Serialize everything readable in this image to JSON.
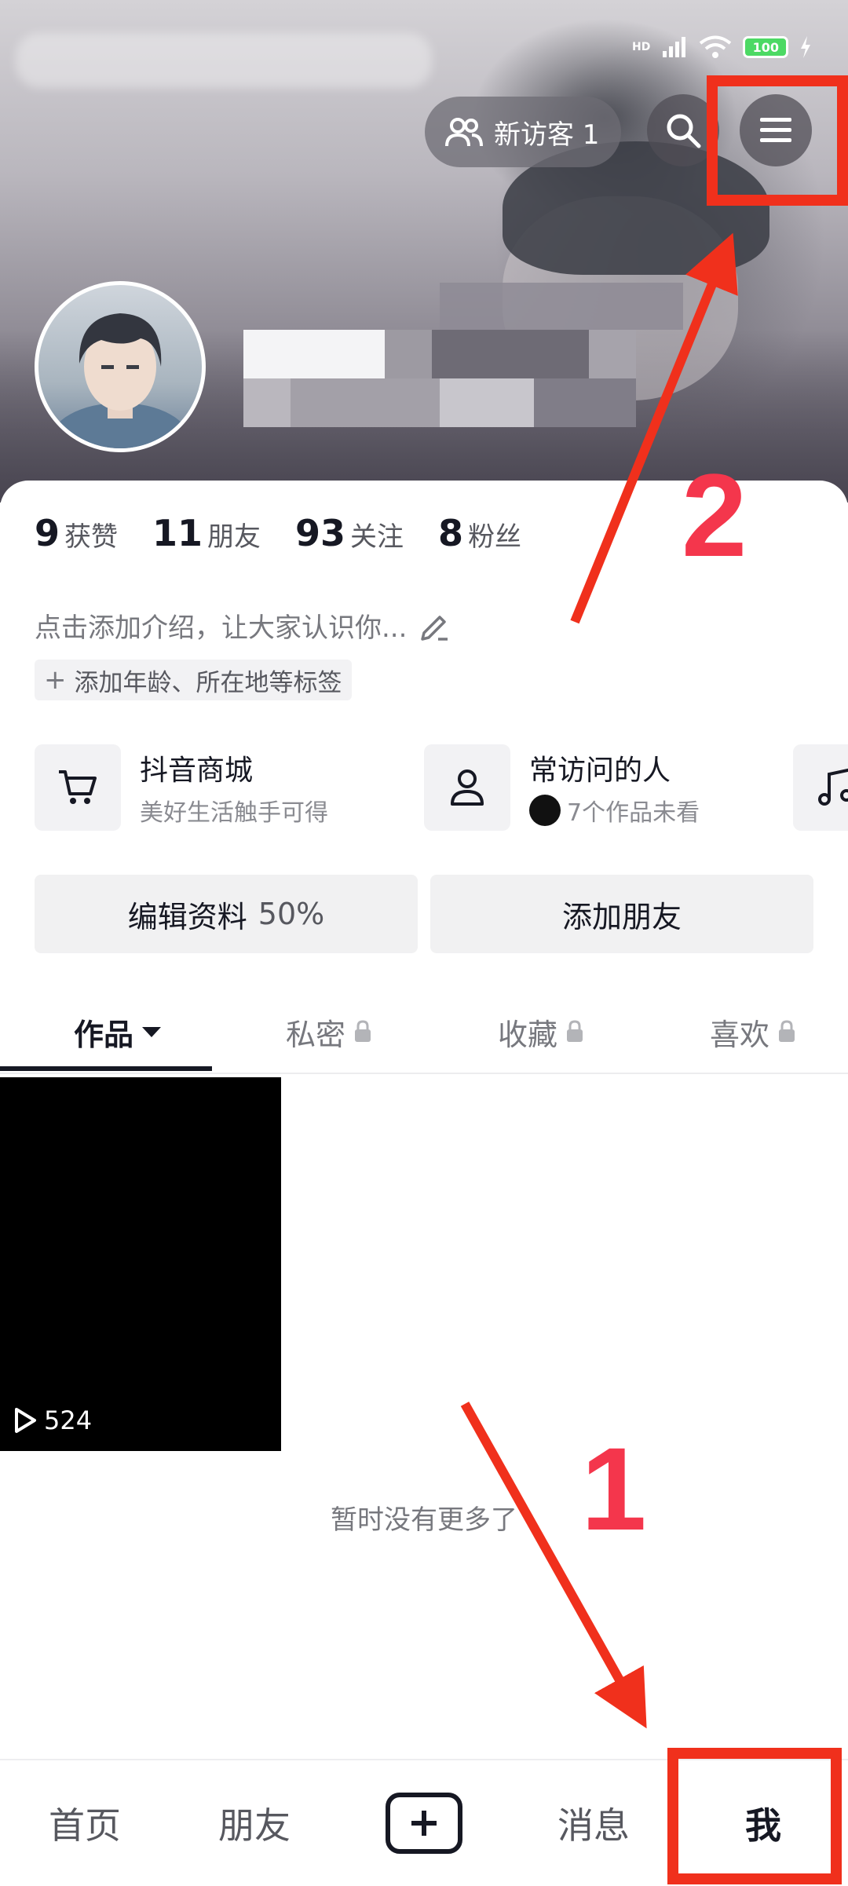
{
  "status_bar": {
    "signal_label": "HD",
    "battery_level": "100"
  },
  "header": {
    "visitor_label": "新访客 1"
  },
  "profile": {
    "name_redacted": true
  },
  "stats": [
    {
      "value": "9",
      "label": "获赞"
    },
    {
      "value": "11",
      "label": "朋友"
    },
    {
      "value": "93",
      "label": "关注"
    },
    {
      "value": "8",
      "label": "粉丝"
    }
  ],
  "bio": {
    "placeholder": "点击添加介绍，让大家认识你...",
    "tag_button": "添加年龄、所在地等标签"
  },
  "shortcuts": [
    {
      "icon": "cart-icon",
      "title": "抖音商城",
      "subtitle": "美好生活触手可得"
    },
    {
      "icon": "person-icon",
      "title": "常访问的人",
      "subtitle": "7个作品未看"
    },
    {
      "icon": "music-note-icon",
      "title": "",
      "subtitle": ""
    }
  ],
  "actions": {
    "edit_profile": "编辑资料",
    "edit_progress": "50%",
    "add_friend": "添加朋友"
  },
  "tabs": [
    {
      "label": "作品",
      "active": true,
      "locked": false
    },
    {
      "label": "私密",
      "active": false,
      "locked": true
    },
    {
      "label": "收藏",
      "active": false,
      "locked": true
    },
    {
      "label": "喜欢",
      "active": false,
      "locked": true
    }
  ],
  "videos": [
    {
      "play_count": "524"
    }
  ],
  "empty_message": "暂时没有更多了",
  "bottom_nav": [
    {
      "label": "首页",
      "active": false
    },
    {
      "label": "朋友",
      "active": false
    },
    {
      "label": "",
      "icon": "plus-icon"
    },
    {
      "label": "消息",
      "active": false
    },
    {
      "label": "我",
      "active": true
    }
  ],
  "annotations": {
    "step_1": "1",
    "step_2": "2",
    "color": "#f0301c"
  }
}
